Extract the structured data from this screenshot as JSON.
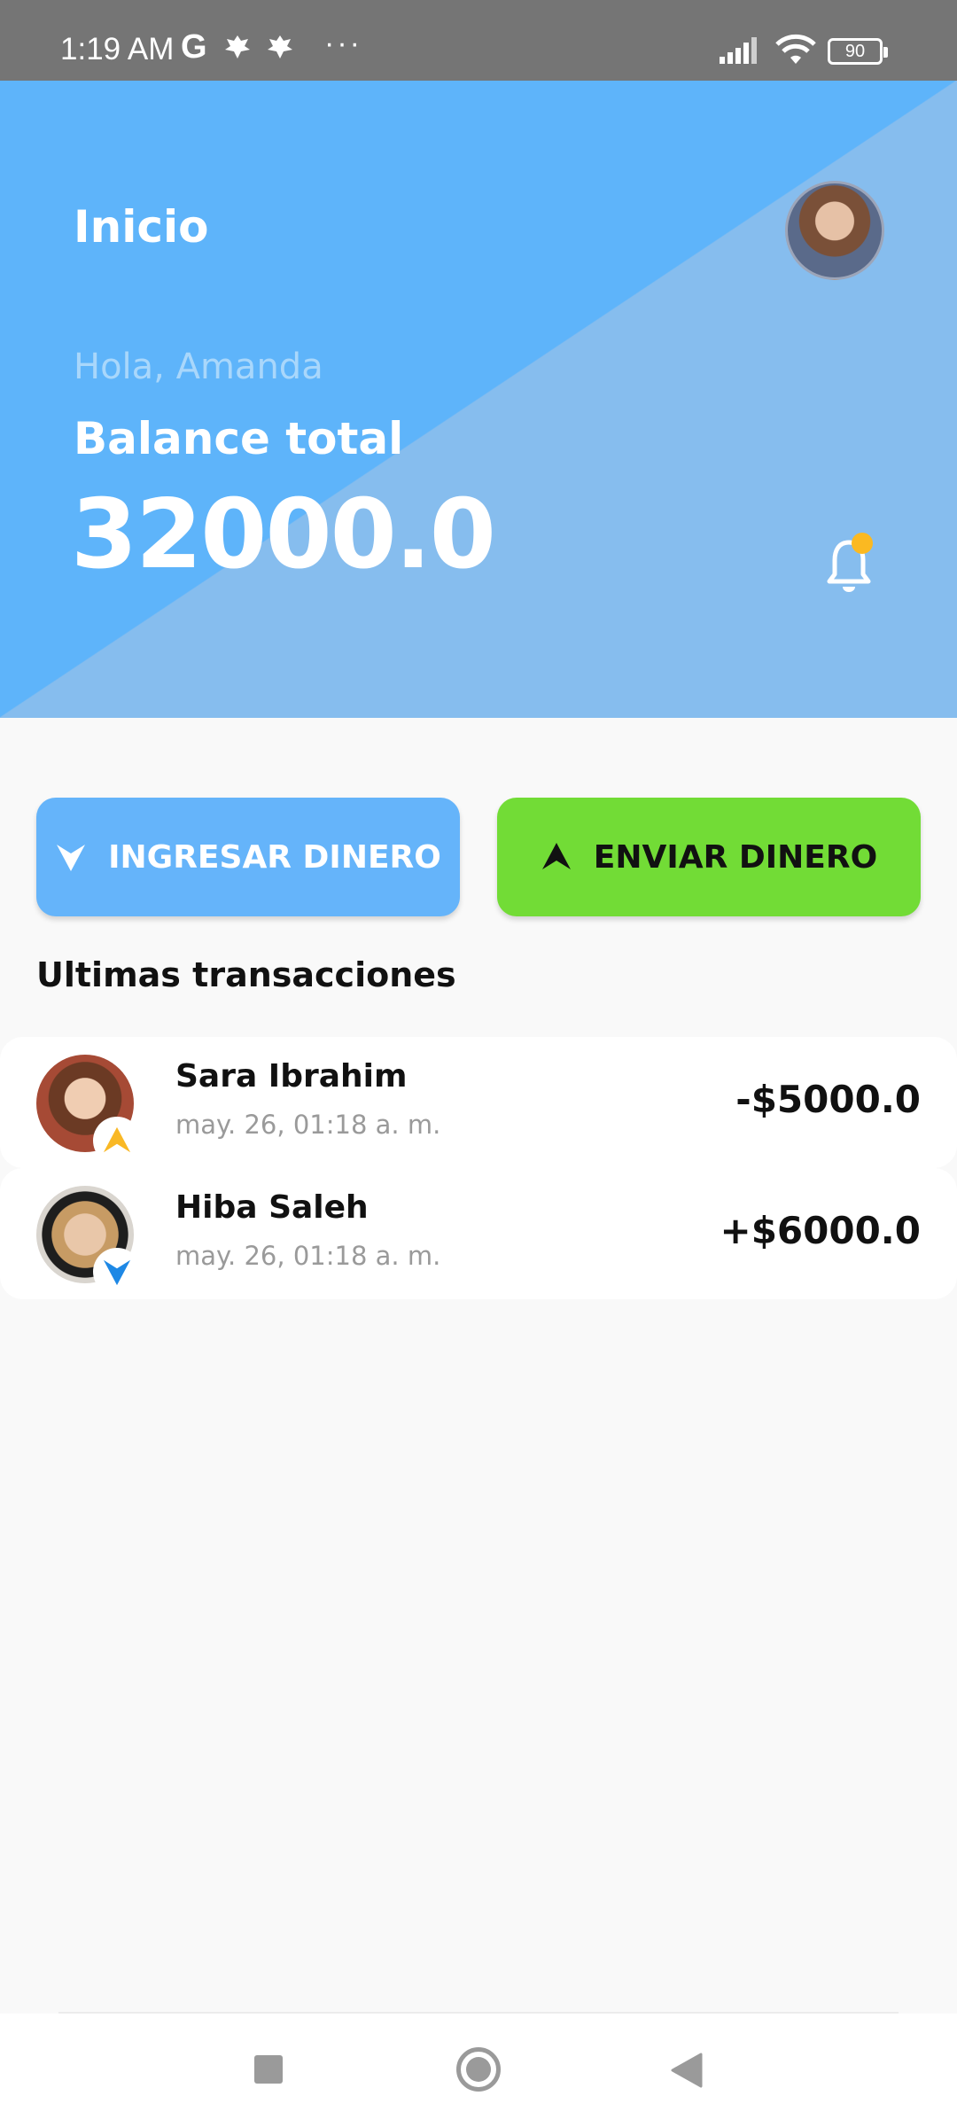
{
  "status_bar": {
    "time": "1:19 AM",
    "carrier_icon": "G",
    "more": "···",
    "battery": "90"
  },
  "header": {
    "title": "Inicio",
    "greeting": "Hola, Amanda",
    "balance_label": "Balance total",
    "balance_value": "32000.0",
    "colors": {
      "primary": "#5eb4fa",
      "secondary": "#86bdee",
      "notification_dot": "#fbb921"
    }
  },
  "actions": {
    "deposit_label": "INGRESAR DINERO",
    "send_label": "ENVIAR DINERO",
    "colors": {
      "deposit": "#65b4fa",
      "send": "#72dc36"
    }
  },
  "transactions": {
    "title": "Ultimas transacciones",
    "items": [
      {
        "name": "Sara Ibrahim",
        "date": "may. 26, 01:18 a. m.",
        "amount": "-$5000.0",
        "type": "send",
        "badge_icon": "arrow-up-icon",
        "badge_color": "#f9b825"
      },
      {
        "name": "Hiba Saleh",
        "date": "may. 26, 01:18 a. m.",
        "amount": "+$6000.0",
        "type": "receive",
        "badge_icon": "arrow-down-icon",
        "badge_color": "#1e88e5"
      }
    ]
  }
}
